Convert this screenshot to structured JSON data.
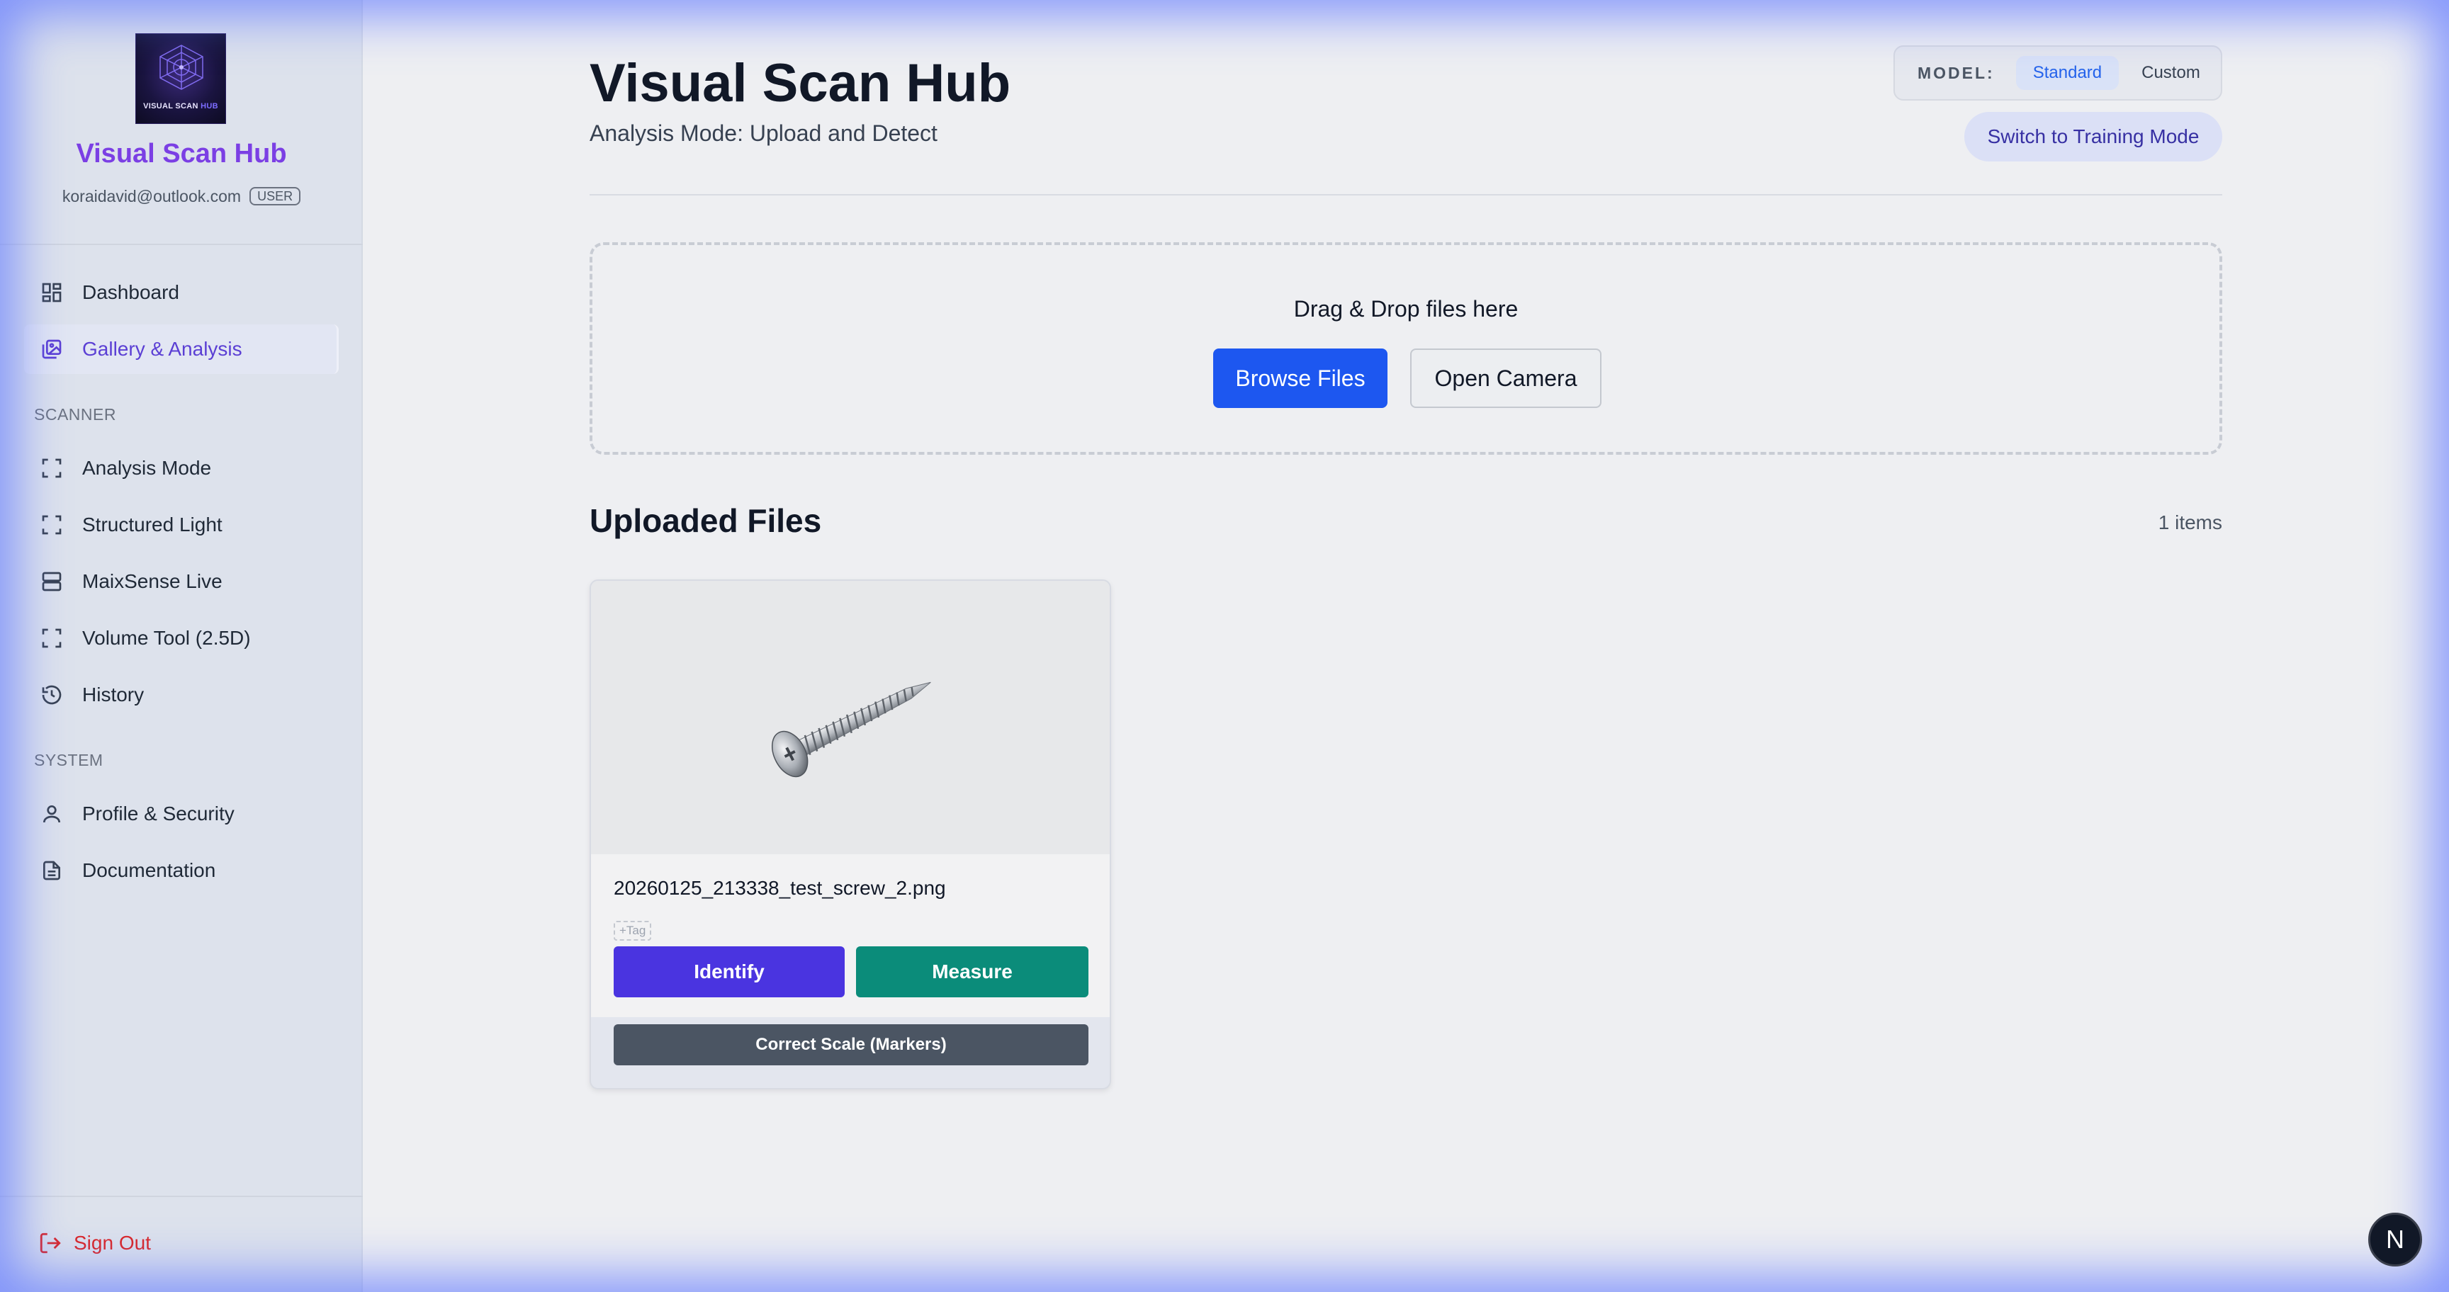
{
  "sidebar": {
    "logo_text_main": "VISUAL SCAN",
    "logo_text_accent": "HUB",
    "brand_name": "Visual Scan Hub",
    "user_email": "koraidavid@outlook.com",
    "user_role": "USER",
    "items": [
      {
        "label": "Dashboard",
        "icon": "grid-icon",
        "active": false
      },
      {
        "label": "Gallery & Analysis",
        "icon": "gallery-icon",
        "active": true
      }
    ],
    "sections": [
      {
        "label": "SCANNER",
        "items": [
          {
            "label": "Analysis Mode",
            "icon": "scan-frame-icon"
          },
          {
            "label": "Structured Light",
            "icon": "scan-frame-icon"
          },
          {
            "label": "MaixSense Live",
            "icon": "server-icon"
          },
          {
            "label": "Volume Tool (2.5D)",
            "icon": "scan-frame-icon"
          },
          {
            "label": "History",
            "icon": "history-icon"
          }
        ]
      },
      {
        "label": "SYSTEM",
        "items": [
          {
            "label": "Profile & Security",
            "icon": "user-icon"
          },
          {
            "label": "Documentation",
            "icon": "document-icon"
          }
        ]
      }
    ],
    "sign_out": "Sign Out"
  },
  "header": {
    "title": "Visual Scan Hub",
    "subtitle": "Analysis Mode: Upload and Detect",
    "model_label": "MODEL:",
    "model_options": [
      "Standard",
      "Custom"
    ],
    "model_selected": "Standard",
    "training_button": "Switch to Training Mode"
  },
  "dropzone": {
    "text": "Drag & Drop files here",
    "browse_label": "Browse Files",
    "camera_label": "Open Camera"
  },
  "uploads": {
    "title": "Uploaded Files",
    "count_label": "1 items",
    "files": [
      {
        "name": "20260125_213338_test_screw_2.png",
        "tag_label": "+Tag",
        "identify_label": "Identify",
        "measure_label": "Measure",
        "scale_label": "Correct Scale (Markers)"
      }
    ]
  },
  "badge": {
    "label": "N"
  },
  "colors": {
    "accent": "#7b3fe4",
    "primary_blue": "#1d57f0",
    "identify": "#4a34e0",
    "measure": "#0b8c7a",
    "danger": "#dc2626"
  }
}
